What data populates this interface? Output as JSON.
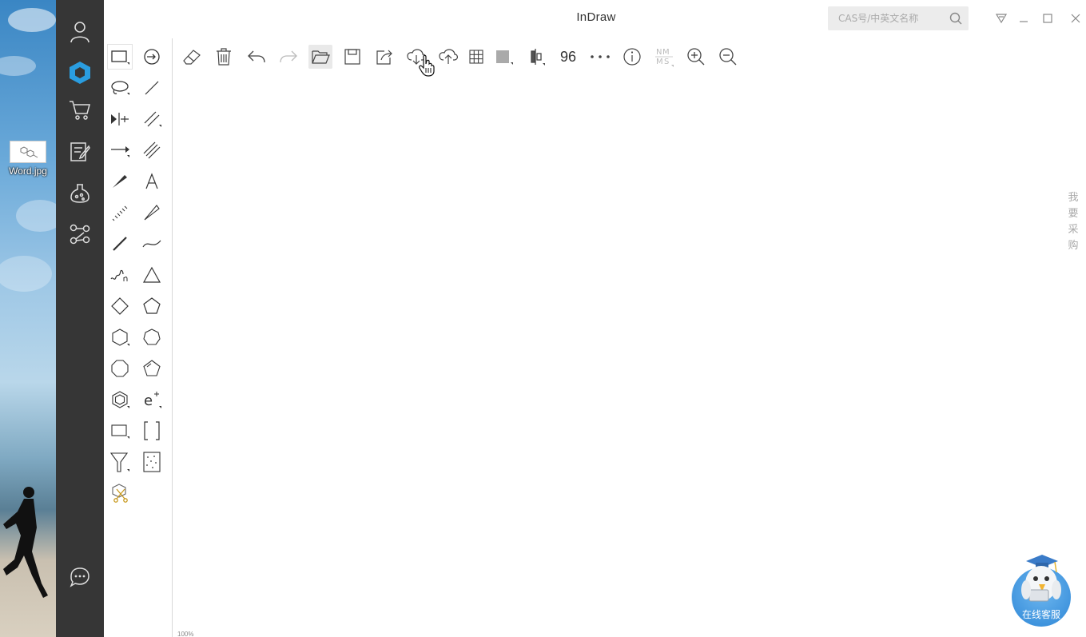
{
  "desktop": {
    "file_name": "Word.jpg"
  },
  "app": {
    "title": "InDraw"
  },
  "search": {
    "placeholder": "CAS号/中英文名称"
  },
  "toolbar": {
    "font_size_value": "96"
  },
  "side_label": {
    "purchase": "我要采购"
  },
  "purchase_chars": [
    "我",
    "要",
    "采",
    "购"
  ],
  "service": {
    "label": "在线客服"
  },
  "canvas": {
    "zoom_text": "100%"
  },
  "colors": {
    "accent": "#2a9de0",
    "sidenav_bg": "#363636"
  }
}
